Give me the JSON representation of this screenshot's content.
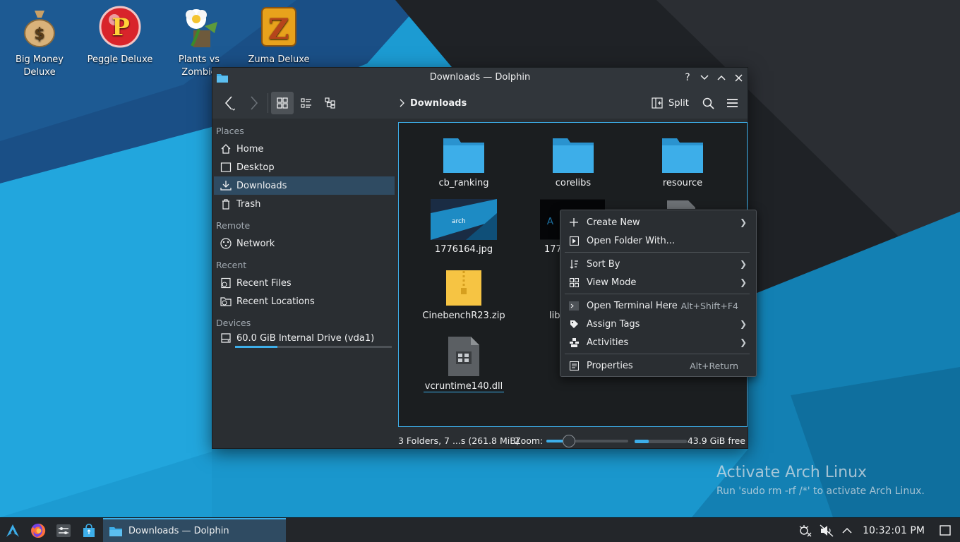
{
  "desktop": {
    "icons": [
      {
        "label": "Big Money\nDeluxe",
        "line1": "Big Money",
        "line2": "Deluxe"
      },
      {
        "label": "Peggle Deluxe",
        "line1": "Peggle Deluxe",
        "line2": ""
      },
      {
        "label": "Plants vs Zombies",
        "line1": "Plants vs",
        "line2": "Zombie"
      },
      {
        "label": "Zuma Deluxe",
        "line1": "Zuma Deluxe",
        "line2": ""
      }
    ],
    "watermark": {
      "title": "Activate Arch Linux",
      "subtitle": "Run 'sudo rm -rf /*' to activate Arch Linux."
    }
  },
  "window": {
    "title": "Downloads — Dolphin",
    "breadcrumb": "Downloads",
    "split_label": "Split"
  },
  "places": {
    "sections": [
      {
        "header": "Places",
        "items": [
          "Home",
          "Desktop",
          "Downloads",
          "Trash"
        ]
      },
      {
        "header": "Remote",
        "items": [
          "Network"
        ]
      },
      {
        "header": "Recent",
        "items": [
          "Recent Files",
          "Recent Locations"
        ]
      },
      {
        "header": "Devices",
        "items": [
          "60.0 GiB Internal Drive (vda1)"
        ]
      }
    ],
    "active": "Downloads",
    "drive_usage": 0.27
  },
  "files": [
    {
      "name": "cb_ranking",
      "type": "folder"
    },
    {
      "name": "corelibs",
      "type": "folder"
    },
    {
      "name": "resource",
      "type": "folder"
    },
    {
      "name": "1776164.jpg",
      "type": "image"
    },
    {
      "name": "177",
      "type": "image"
    },
    {
      "name": "CinebenchR23.zip",
      "type": "archive"
    },
    {
      "name": "lib",
      "type": "file"
    },
    {
      "name": "vcruntime140.dll",
      "type": "dll"
    }
  ],
  "status": {
    "summary": "3 Folders, 7 ...s (261.8 MiB)",
    "zoom_label": "Zoom:",
    "zoom_level": 0.28,
    "free_space": "43.9 GiB free",
    "free_usage": 0.27
  },
  "context_menu": {
    "items": [
      {
        "label": "Create New",
        "shortcut": "",
        "submenu": true
      },
      {
        "label": "Open Folder With...",
        "shortcut": "",
        "submenu": false
      },
      {
        "label": "Sort By",
        "shortcut": "",
        "submenu": true
      },
      {
        "label": "View Mode",
        "shortcut": "",
        "submenu": true
      },
      {
        "label": "Open Terminal Here",
        "shortcut": "Alt+Shift+F4",
        "submenu": false
      },
      {
        "label": "Assign Tags",
        "shortcut": "",
        "submenu": true
      },
      {
        "label": "Activities",
        "shortcut": "",
        "submenu": true
      },
      {
        "label": "Properties",
        "shortcut": "Alt+Return",
        "submenu": false
      }
    ]
  },
  "taskbar": {
    "task_title": "Downloads — Dolphin",
    "clock": "10:32:01 PM"
  },
  "colors": {
    "accent": "#3daee9",
    "window_bg": "#2a2e32",
    "view_bg": "#1b1e20",
    "taskbar_bg": "#23262a",
    "folder": "#3daee9"
  }
}
